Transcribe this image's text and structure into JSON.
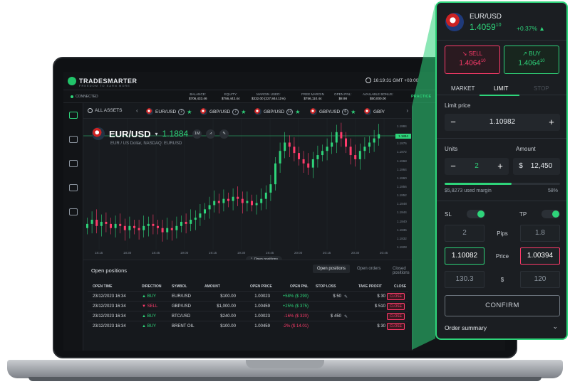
{
  "app": {
    "logo": "TRADESMARTER",
    "logo_sub": "FREEDOM TO EARN MORE",
    "clock": "16:19:31 GMT +03:00"
  },
  "account": {
    "connection": "CONNECTED",
    "balance_label": "BALANCE:",
    "balance": "$706,433.46",
    "equity_label": "EQUITY:",
    "equity": "$756,442.44",
    "margin_used_label": "MARGIN USED:",
    "margin_used": "$332.00 (227,844.11%)",
    "free_margin_label": "FREE MARGIN",
    "free_margin": "$756,110.44",
    "open_pnl_label": "OPEN PNL:",
    "open_pnl": "$8.98",
    "bonus_label": "AVAILABLE BONUS:",
    "bonus": "$50,000.00",
    "mode": "PRACTICE"
  },
  "tabs": {
    "all_assets": "ALL ASSETS",
    "items": [
      {
        "symbol": "EUR/USD",
        "count": "2"
      },
      {
        "symbol": "GBP/USD",
        "count": "7"
      },
      {
        "symbol": "GBP/USD",
        "count": "12"
      },
      {
        "symbol": "GBP/USD",
        "count": "6"
      },
      {
        "symbol": "GBP/",
        "count": ""
      }
    ]
  },
  "chart": {
    "symbol": "EUR/USD",
    "price": "1.1884",
    "timeframe": "1M",
    "subtitle": "EUR / US Dollar, NASDAQ: EURUSD",
    "price_tag": "1.1884",
    "open_positions_pill": "Open positions"
  },
  "chart_data": {
    "type": "candlestick",
    "x_ticks": [
      "18:15",
      "18:30",
      "18:45",
      "19:00",
      "19:15",
      "19:30",
      "19:45",
      "20:00",
      "20:15",
      "20:30",
      "20:45"
    ],
    "y_ticks": [
      "1.1884",
      "1.1880",
      "1.1876",
      "1.1872",
      "1.1868",
      "1.1864",
      "1.1860",
      "1.1856",
      "1.1852",
      "1.1848",
      "1.1844",
      "1.1840",
      "1.1836",
      "1.1832",
      "1.1828"
    ],
    "close_path": [
      1.1841,
      1.1843,
      1.184,
      1.1842,
      1.1841,
      1.1839,
      1.1841,
      1.184,
      1.1838,
      1.184,
      1.1839,
      1.1838,
      1.184,
      1.1841,
      1.184,
      1.1839,
      1.1837,
      1.1839,
      1.1838,
      1.184,
      1.1842,
      1.1841,
      1.1843,
      1.1844,
      1.1846,
      1.1848,
      1.185,
      1.1852,
      1.1851,
      1.1853,
      1.1852,
      1.1854,
      1.1853,
      1.1851,
      1.1852,
      1.185,
      1.1851,
      1.1853,
      1.1856,
      1.186,
      1.187,
      1.1876,
      1.188,
      1.1878,
      1.1875,
      1.1872,
      1.187,
      1.1868,
      1.1872,
      1.1874,
      1.1876,
      1.1878,
      1.188,
      1.1885,
      1.1882,
      1.1878,
      1.1874,
      1.1872,
      1.1876,
      1.1878,
      1.188,
      1.1882,
      1.1884
    ]
  },
  "positions": {
    "title": "Open positions",
    "tabs": [
      "Open positions",
      "Open orders",
      "Closed positions"
    ],
    "headers": [
      "OPEN TIME",
      "DIRECTION",
      "SYMBOL",
      "AMOUNT",
      "OPEN PRICE",
      "OPEN PNL",
      "STOP LOSS",
      "TAKE PROFIT",
      "CLOSE"
    ],
    "rows": [
      {
        "time": "23/12/2023 16:34",
        "dir": "BUY",
        "symbol": "EUR/USD",
        "amount": "$100.00",
        "open_price": "1.00023",
        "pnl": "+58% ($ 290)",
        "sl": "$ 50",
        "tp": "$ 30",
        "close": "CLOSE"
      },
      {
        "time": "23/12/2023 16:34",
        "dir": "SELL",
        "symbol": "GBP/USD",
        "amount": "$1,000.00",
        "open_price": "1.00459",
        "pnl": "+25% ($ 375)",
        "sl": "",
        "tp": "$ 510",
        "close": "CLOSE"
      },
      {
        "time": "23/12/2023 16:34",
        "dir": "BUY",
        "symbol": "BTC/USD",
        "amount": "$240.00",
        "open_price": "1.00023",
        "pnl": "-16% ($ 320)",
        "sl": "$ 450",
        "tp": "",
        "close": "CLOSE"
      },
      {
        "time": "23/12/2023 16:34",
        "dir": "BUY",
        "symbol": "BRENT OIL",
        "amount": "$100.00",
        "open_price": "1.00459",
        "pnl": "-2% ($ 14.01)",
        "sl": "",
        "tp": "$ 30",
        "close": "CLOSE"
      }
    ]
  },
  "panel": {
    "symbol": "EUR/USD",
    "price_main": "1.4059",
    "price_sup": "10",
    "change": "+0.37% ▲",
    "sell_label": "SELL",
    "sell_price": "1.4064",
    "sell_sup": "10",
    "buy_label": "BUY",
    "buy_price": "1.4064",
    "buy_sup": "10",
    "tab_market": "MARKET",
    "tab_limit": "LIMIT",
    "tab_stop": "STOP",
    "limit_price_label": "Limit price",
    "limit_price": "1.10982",
    "units_label": "Units",
    "units": "2",
    "amount_label": "Amount",
    "amount_symbol": "$",
    "amount": "12,450",
    "margin_text": "$5,8273 used margin",
    "margin_pct": "58%",
    "margin_fraction": 0.58,
    "sl_label": "SL",
    "tp_label": "TP",
    "pips_label": "Pips",
    "price_label": "Price",
    "dollar_label": "$",
    "sl_pips": "2",
    "tp_pips": "1.8",
    "sl_price": "1.10082",
    "tp_price": "1.00394",
    "sl_amount": "130.3",
    "tp_amount": "120",
    "confirm": "CONFIRM",
    "summary": "Order summary"
  },
  "colors": {
    "accent": "#2ed47a",
    "sell": "#ff3b6b",
    "bg": "#16191d"
  }
}
